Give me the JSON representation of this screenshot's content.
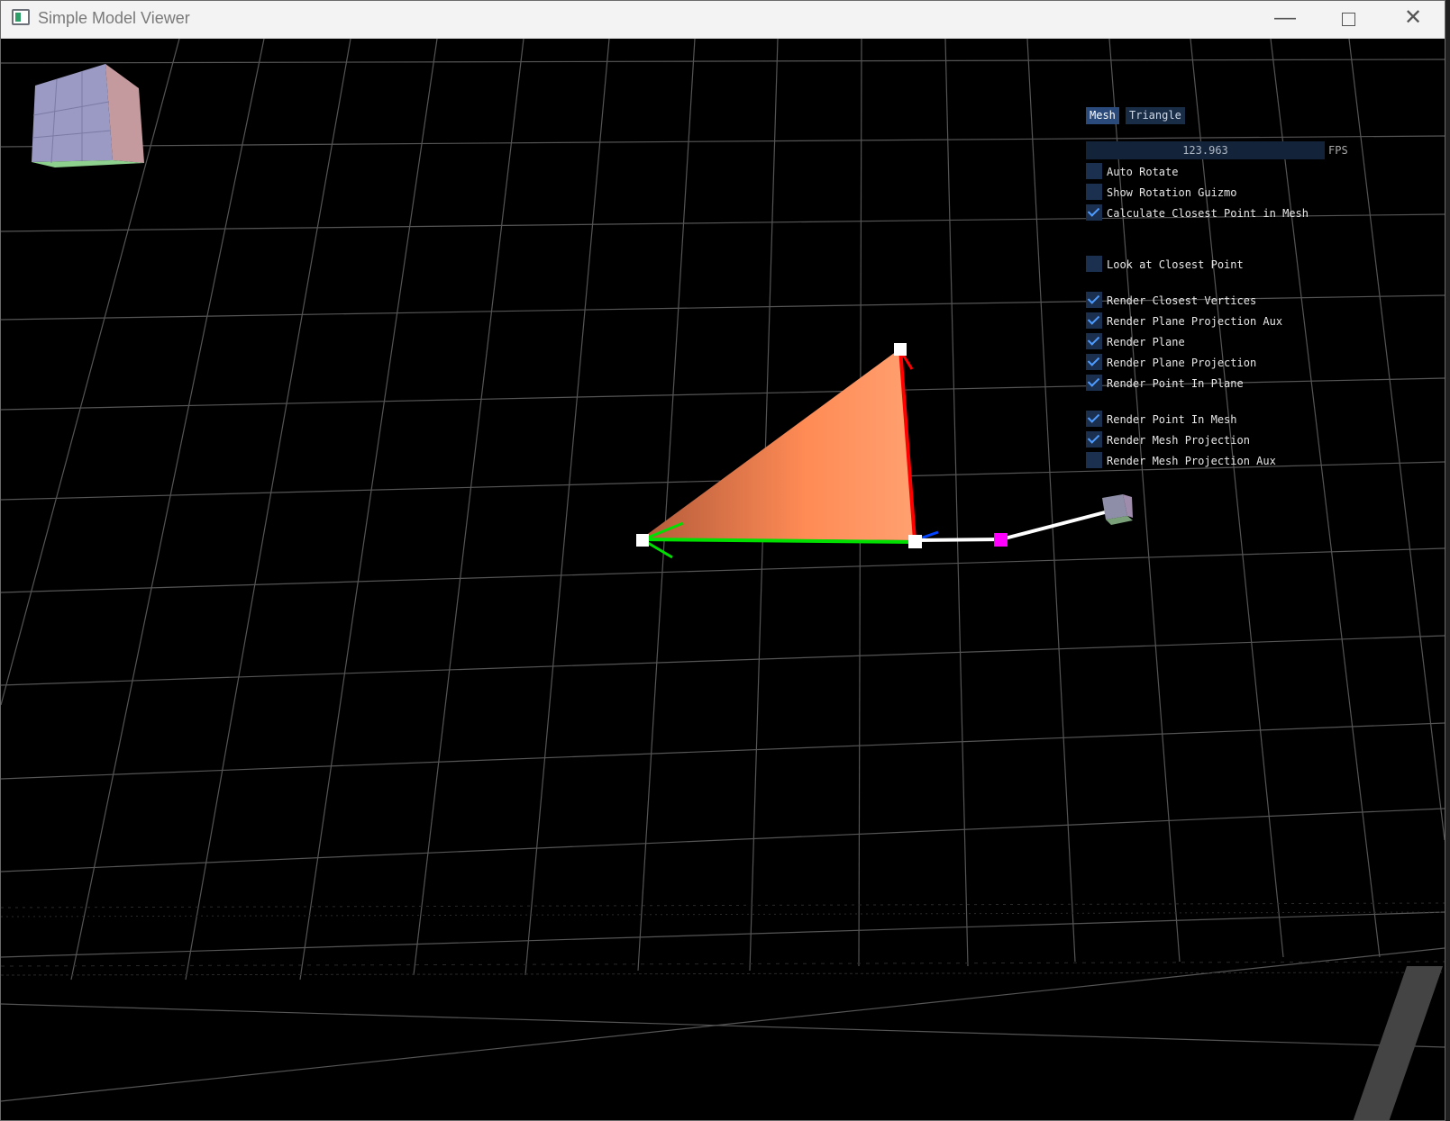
{
  "window": {
    "title": "Simple Model Viewer",
    "minimize_glyph": "—",
    "close_glyph": "✕"
  },
  "tabs": [
    {
      "label": "Mesh",
      "active": true
    },
    {
      "label": "Triangle",
      "active": false
    }
  ],
  "fps": {
    "value": "123.963",
    "label": "FPS"
  },
  "options": [
    {
      "label": "Auto Rotate",
      "checked": false
    },
    {
      "label": "Show Rotation Guizmo",
      "checked": false
    },
    {
      "label": "Calculate Closest Point in Mesh",
      "checked": true
    },
    {
      "label": "Look at Closest Point",
      "checked": false
    },
    {
      "label": "Render Closest Vertices",
      "checked": true
    },
    {
      "label": "Render Plane Projection Aux",
      "checked": true
    },
    {
      "label": "Render Plane",
      "checked": true
    },
    {
      "label": "Render Plane Projection",
      "checked": true
    },
    {
      "label": "Render Point In Plane",
      "checked": true
    },
    {
      "label": "Render Point In Mesh",
      "checked": true
    },
    {
      "label": "Render Mesh Projection",
      "checked": true
    },
    {
      "label": "Render Mesh Projection Aux",
      "checked": false
    }
  ],
  "colors": {
    "triangle": "#ff8b55",
    "grid": "#555555",
    "x_axis": "#ff0000",
    "y_axis": "#00ff00",
    "mesh_point": "#ff00ff",
    "checkbox_tick": "#4f9cff"
  }
}
